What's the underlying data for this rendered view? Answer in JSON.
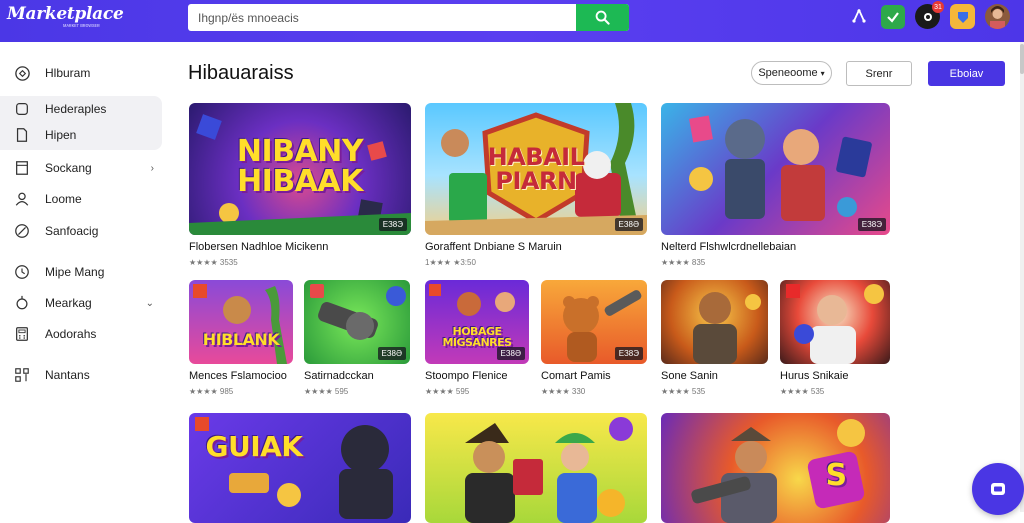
{
  "header": {
    "logo": "Marketplace",
    "logo_sub": "ᴍᴀʀᴋᴇᴛ ʙʀᴏᴡsᴇʀ",
    "search_placeholder": "Ihgnp/ës mnoeacis",
    "icons": [
      "search-icon",
      "upload-icon",
      "downloads-icon",
      "notifications-icon",
      "rewards-icon",
      "profile-avatar"
    ],
    "notification_count": "31"
  },
  "sidebar": {
    "items": [
      {
        "label": "Hlburam",
        "icon": "home-icon"
      },
      {
        "label": "Hederaples",
        "icon": "library-icon"
      },
      {
        "label": "Hipen",
        "icon": "document-icon"
      },
      {
        "label": "Sockang",
        "icon": "store-icon",
        "expandable": true
      },
      {
        "label": "Loome",
        "icon": "user-icon"
      },
      {
        "label": "Sanfoacig",
        "icon": "tag-icon"
      },
      {
        "label": "Mipe Mang",
        "icon": "history-icon"
      },
      {
        "label": "Mearkag",
        "icon": "settings-icon",
        "expandable": true
      },
      {
        "label": "Aodorahs",
        "icon": "calculator-icon"
      },
      {
        "label": "Nantans",
        "icon": "network-icon"
      }
    ]
  },
  "main": {
    "title": "Hibauaraiss",
    "sort_label": "Speneoome",
    "secondary_button": "Srenr",
    "primary_button": "Eboiav"
  },
  "games": [
    {
      "name": "Flobersen Nadhloe Micikenn",
      "rating": "★★★★ 3535",
      "price": "ЕЗ8Э",
      "art_title": "NIBANY HIBAAK"
    },
    {
      "name": "Goraffent Dnbiane S Maruin",
      "rating": "1★★★ ★3:50",
      "price": "ЕЗ8Ә",
      "art_title": "HABAIL PIARN"
    },
    {
      "name": "Nelterd Flshwlcrdnellebaian",
      "rating": "★★★★ 835",
      "price": "ЕЗ8Э",
      "art_title": ""
    },
    {
      "name": "Mences Fslamocioo",
      "rating": "★★★★ 985",
      "price": "",
      "art_title": "HIBLANK"
    },
    {
      "name": "Satirnadcckan",
      "rating": "★★★★ 595",
      "price": "ЕЗ8Ә",
      "art_title": ""
    },
    {
      "name": "Stoompo Flenice",
      "rating": "★★★★ 595",
      "price": "ЕЗ8Ә",
      "art_title": "HOBAGE MIGSANRES"
    },
    {
      "name": "Comart Pamis",
      "rating": "★★★★ 330",
      "price": "ЕЗ8Э",
      "art_title": ""
    },
    {
      "name": "Sone Sanin",
      "rating": "★★★★ 535",
      "price": "",
      "art_title": ""
    },
    {
      "name": "Hurus Snikaie",
      "rating": "★★★★ 535",
      "price": "",
      "art_title": ""
    },
    {
      "name": "",
      "rating": "",
      "price": "",
      "art_title": "GUIAK"
    },
    {
      "name": "",
      "rating": "",
      "price": "",
      "art_title": ""
    },
    {
      "name": "",
      "rating": "",
      "price": "",
      "art_title": "S"
    }
  ],
  "colors": {
    "header_bg": "#4b37e6",
    "primary": "#4935e3",
    "search_button": "#1db954"
  }
}
